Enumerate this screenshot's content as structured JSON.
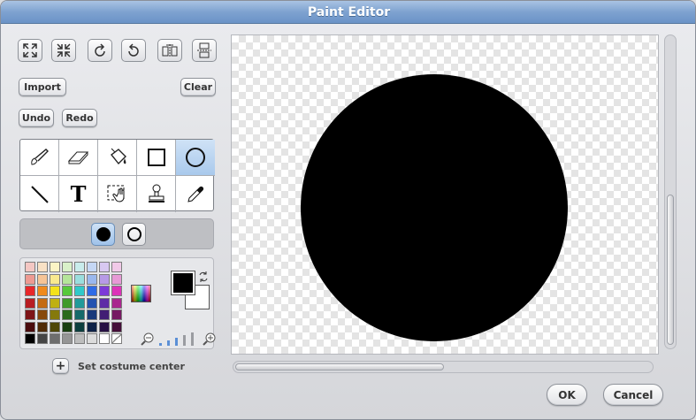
{
  "window": {
    "title": "Paint Editor"
  },
  "toolbar": {
    "icons": [
      "grow-icon",
      "shrink-icon",
      "rotate-left-icon",
      "rotate-right-icon",
      "flip-horizontal-icon",
      "flip-vertical-icon"
    ],
    "import_label": "Import",
    "clear_label": "Clear",
    "undo_label": "Undo",
    "redo_label": "Redo"
  },
  "tools": {
    "items": [
      "paintbrush",
      "eraser",
      "fill",
      "rectangle",
      "ellipse",
      "line",
      "text",
      "select",
      "stamp",
      "eyedropper"
    ],
    "selected": "ellipse",
    "text_tool_glyph": "T"
  },
  "shape_options": {
    "selected": "filled"
  },
  "colors": {
    "foreground": "#000000",
    "background": "#ffffff",
    "palette": [
      [
        "#f4c7c3",
        "#f9e1c5",
        "#fbf4c5",
        "#d9f1c9",
        "#c9ecec",
        "#c5d7f5",
        "#d8c8f1",
        "#f1c9e8"
      ],
      [
        "#ee9a92",
        "#f6c496",
        "#f8e98f",
        "#b5e59a",
        "#9adede",
        "#9ab8ee",
        "#b79ae6",
        "#e79ad6"
      ],
      [
        "#e8272a",
        "#f08a1d",
        "#f4e21a",
        "#57c93b",
        "#30c9c9",
        "#2f6ce6",
        "#7d3ad8",
        "#dc33b9"
      ],
      [
        "#b81e22",
        "#c46b12",
        "#bfb012",
        "#3f9a2a",
        "#229a9a",
        "#2453b0",
        "#5e2ca6",
        "#a9268e"
      ],
      [
        "#7e1518",
        "#87490c",
        "#85790c",
        "#2b6a1c",
        "#166a6a",
        "#193a7a",
        "#421e74",
        "#761a63"
      ],
      [
        "#4a0c0e",
        "#502b07",
        "#4f4707",
        "#193e10",
        "#0d3e3e",
        "#0e2247",
        "#271144",
        "#450f3a"
      ],
      [
        "#000000",
        "#454545",
        "#6e6e6e",
        "#959595",
        "#bdbdbd",
        "#dcdcdc",
        "#ffffff",
        "#transparent"
      ]
    ]
  },
  "zoom": {
    "level": 3,
    "max": 5
  },
  "costume_center_label": "Set costume center",
  "canvas": {
    "shape_color": "#000000"
  },
  "scroll": {
    "vertical": 0.5,
    "horizontal": 0.0
  },
  "footer": {
    "ok_label": "OK",
    "cancel_label": "Cancel"
  }
}
